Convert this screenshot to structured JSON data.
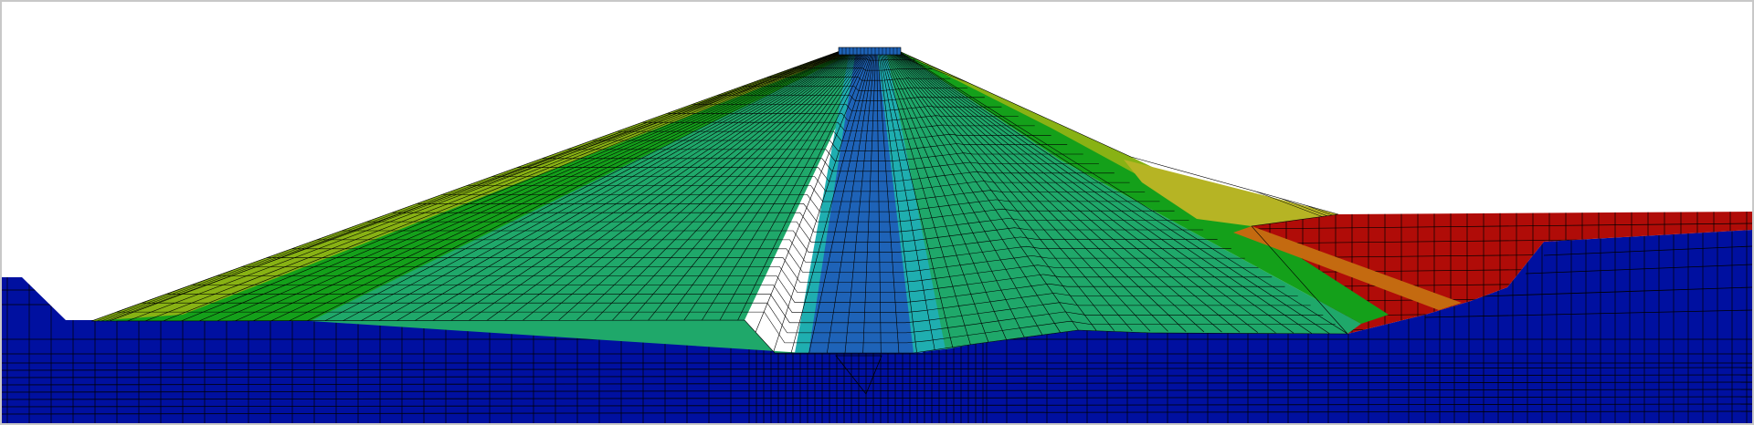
{
  "scene": {
    "type": "finite-element-mesh-contour",
    "subject": "dam-cross-section",
    "legend_visible": false,
    "text_labels": []
  },
  "colors": {
    "background": "#ffffff",
    "frame": "#c8c8c8",
    "foundation": "#0010a0",
    "core_inner": "#1e63b8",
    "core_band": "#1faeb0",
    "shell_mid": "#1fa86a",
    "shell_outer": "#14a01a",
    "slope_olive": "#88b214",
    "slope_yellow": "#b6b424",
    "slope_orange": "#c46a10",
    "reservoir_red": "#b00c08",
    "mesh_line": "#000000"
  }
}
